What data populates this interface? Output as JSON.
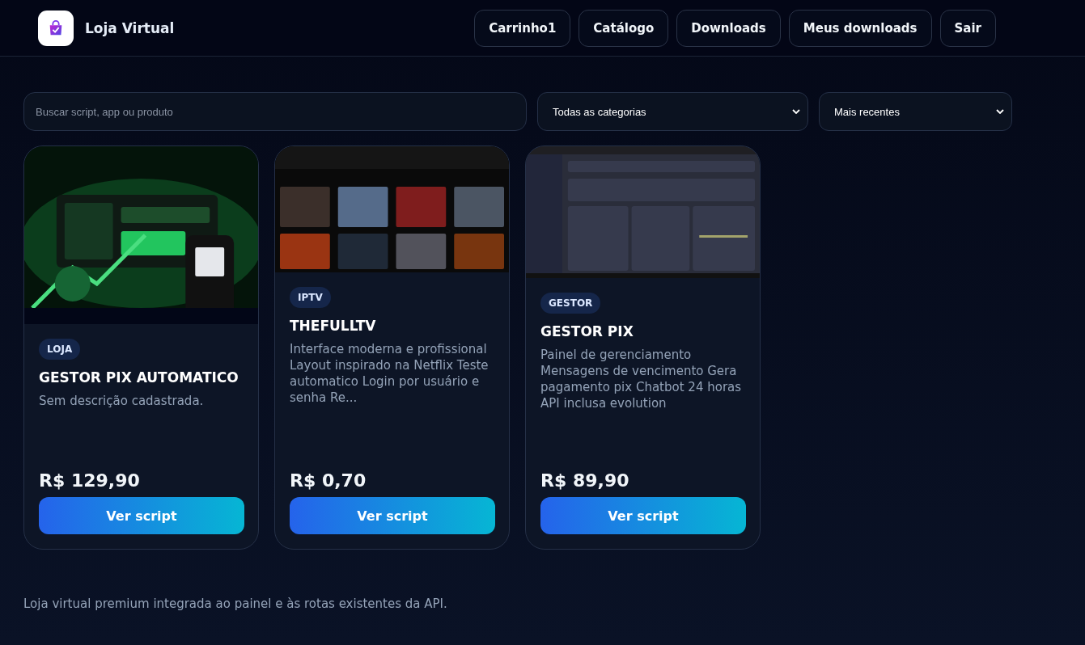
{
  "header": {
    "brand": "Loja Virtual",
    "nav": [
      {
        "label": "Carrinho1"
      },
      {
        "label": "Catálogo"
      },
      {
        "label": "Downloads"
      },
      {
        "label": "Meus downloads"
      },
      {
        "label": "Sair"
      }
    ]
  },
  "filters": {
    "search": {
      "placeholder": "Buscar script, app ou produto"
    },
    "category": {
      "value": "Todas as categorias"
    },
    "sort": {
      "value": "Mais recentes"
    }
  },
  "products": [
    {
      "tag": "LOJA",
      "title": "GESTOR PIX AUTOMATICO",
      "description": "Sem descrição cadastrada.",
      "price": "R$ 129,90",
      "button": "Ver script"
    },
    {
      "tag": "IPTV",
      "title": "THEFULLTV",
      "description": "Interface moderna e profissional Layout inspirado na Netflix Teste automatico Login por usuário e senha Re...",
      "price": "R$ 0,70",
      "button": "Ver script"
    },
    {
      "tag": "GESTOR",
      "title": "GESTOR PIX",
      "description": "Painel de gerenciamento Mensagens de vencimento Gera pagamento pix Chatbot 24 horas API inclusa evolution",
      "price": "R$ 89,90",
      "button": "Ver script"
    }
  ],
  "footer": "Loja virtual premium integrada ao painel e às rotas existentes da API."
}
